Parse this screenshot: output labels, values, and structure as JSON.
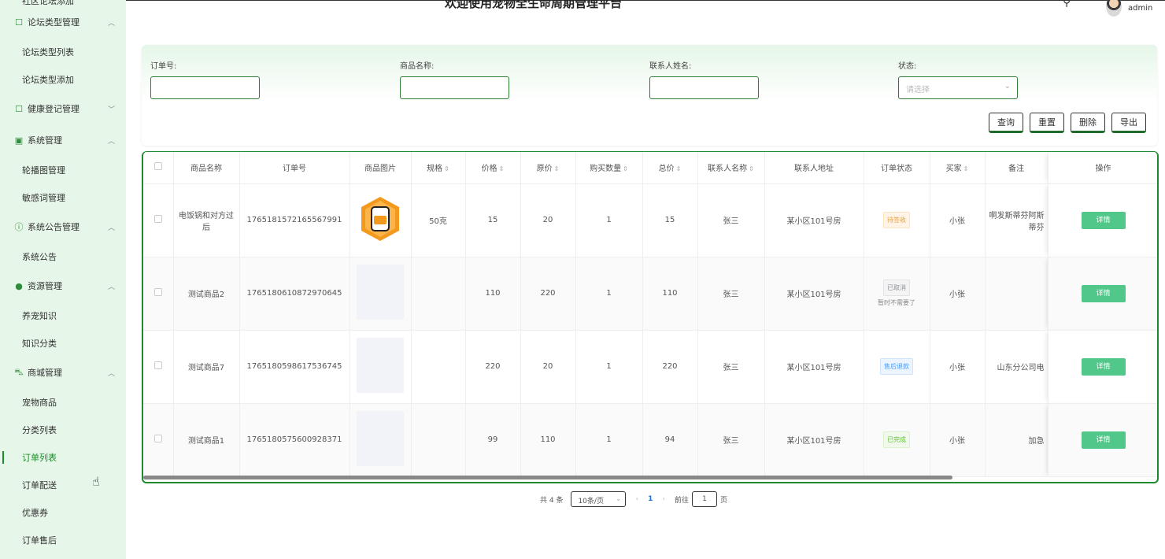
{
  "sidebar": {
    "top_cut": "社区论坛添加",
    "sections": [
      {
        "label": "论坛类型管理",
        "icon": "plus-square-icon",
        "expanded": true,
        "items": [
          "论坛类型列表",
          "论坛类型添加"
        ]
      },
      {
        "label": "健康登记管理",
        "icon": "plus-square-icon",
        "expanded": false,
        "items": []
      },
      {
        "label": "系统管理",
        "icon": "image-icon",
        "expanded": true,
        "items": [
          "轮播图管理",
          "敏感词管理"
        ]
      },
      {
        "label": "系统公告管理",
        "icon": "info-circle-icon",
        "expanded": true,
        "items": [
          "系统公告"
        ]
      },
      {
        "label": "资源管理",
        "icon": "location-icon",
        "expanded": true,
        "items": [
          "养宠知识",
          "知识分类"
        ]
      },
      {
        "label": "商城管理",
        "icon": "cart-icon",
        "expanded": true,
        "items": [
          "宠物商品",
          "分类列表",
          "订单列表",
          "订单配送",
          "优惠券",
          "订单售后"
        ]
      }
    ]
  },
  "header": {
    "title": "欢迎使用宠物全生命周期管理平台",
    "user": "admin"
  },
  "search": {
    "order_no_label": "订单号:",
    "product_name_label": "商品名称:",
    "contact_name_label": "联系人姓名:",
    "status_label": "状态:",
    "status_placeholder": "请选择",
    "buttons": {
      "query": "查询",
      "reset": "重置",
      "delete": "删除",
      "export": "导出"
    }
  },
  "table": {
    "headers": [
      "商品名称",
      "订单号",
      "商品图片",
      "规格",
      "价格",
      "原价",
      "购买数量",
      "总价",
      "联系人名称",
      "联系人地址",
      "订单状态",
      "买家",
      "备注",
      "操作"
    ],
    "rows": [
      {
        "name": "电饭锅和对方过后",
        "order_no": "1765181572165567991",
        "spec": "50克",
        "price": "15",
        "orig": "20",
        "qty": "1",
        "total": "15",
        "contact": "张三",
        "address": "某小区101号房",
        "status": "待签收",
        "status_sub": "",
        "buyer": "小张",
        "remark": "啊发斯蒂芬阿斯蒂芬",
        "action": "详情"
      },
      {
        "name": "测试商品2",
        "order_no": "1765180610872970645",
        "spec": "",
        "price": "110",
        "orig": "220",
        "qty": "1",
        "total": "110",
        "contact": "张三",
        "address": "某小区101号房",
        "status": "已取消",
        "status_sub": "暂时不需要了",
        "buyer": "小张",
        "remark": "",
        "action": "详情"
      },
      {
        "name": "测试商品7",
        "order_no": "1765180598617536745",
        "spec": "",
        "price": "220",
        "orig": "20",
        "qty": "1",
        "total": "220",
        "contact": "张三",
        "address": "某小区101号房",
        "status": "售后退款",
        "status_sub": "",
        "buyer": "小张",
        "remark": "山东分公司电",
        "action": "详情"
      },
      {
        "name": "测试商品1",
        "order_no": "1765180575600928371",
        "spec": "",
        "price": "99",
        "orig": "110",
        "qty": "1",
        "total": "94",
        "contact": "张三",
        "address": "某小区101号房",
        "status": "已完成",
        "status_sub": "",
        "buyer": "小张",
        "remark": "加急",
        "action": "详情"
      }
    ]
  },
  "pager": {
    "total": "共 4 条",
    "page_size": "10条/页",
    "current": "1",
    "goto_label": "前往",
    "goto_value": "1",
    "page_unit": "页"
  },
  "colors": {
    "accent": "#1f8c2b",
    "sidebar_bg": "#e6f6e8",
    "detail_btn": "#52c78a"
  }
}
